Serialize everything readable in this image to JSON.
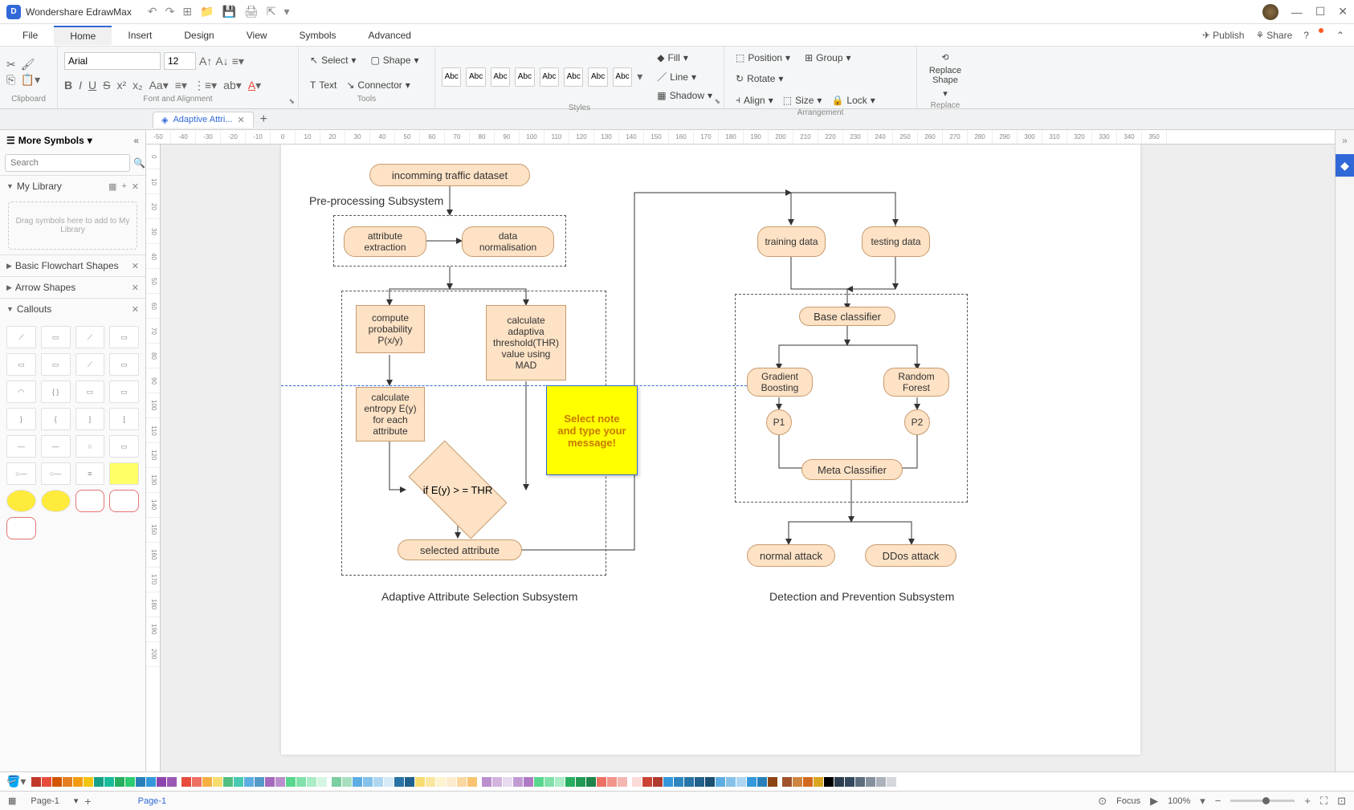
{
  "app": {
    "name": "Wondershare EdrawMax"
  },
  "qat_icons": [
    "undo-icon",
    "redo-icon",
    "new-icon",
    "open-icon",
    "save-icon",
    "print-icon",
    "export-icon",
    "more-icon"
  ],
  "menu": {
    "items": [
      "File",
      "Home",
      "Insert",
      "Design",
      "View",
      "Symbols",
      "Advanced"
    ],
    "active": 1,
    "publish": "Publish",
    "share": "Share"
  },
  "ribbon": {
    "clipboard_label": "Clipboard",
    "font_label": "Font and Alignment",
    "tools_label": "Tools",
    "styles_label": "Styles",
    "arrangement_label": "Arrangement",
    "replace_label": "Replace",
    "font_name": "Arial",
    "font_size": "12",
    "select": "Select",
    "shape": "Shape",
    "text": "Text",
    "connector": "Connector",
    "style_swatch": "Abc",
    "fill": "Fill",
    "line": "Line",
    "shadow": "Shadow",
    "position": "Position",
    "group": "Group",
    "align": "Align",
    "size": "Size",
    "rotate": "Rotate",
    "lock": "Lock",
    "replace_shape": "Replace Shape"
  },
  "doc_tab": {
    "name": "Adaptive Attri..."
  },
  "left": {
    "title": "More Symbols",
    "search_placeholder": "Search",
    "my_library": "My Library",
    "drop_hint": "Drag symbols here to add to My Library",
    "sections": [
      "Basic Flowchart Shapes",
      "Arrow Shapes",
      "Callouts"
    ]
  },
  "ruler_h": [
    "-50",
    "-40",
    "-30",
    "-20",
    "-10",
    "0",
    "10",
    "20",
    "30",
    "40",
    "50",
    "60",
    "70",
    "80",
    "90",
    "100",
    "110",
    "120",
    "130",
    "140",
    "150",
    "160",
    "170",
    "180",
    "190",
    "200",
    "210",
    "220",
    "230",
    "240",
    "250",
    "260",
    "270",
    "280",
    "290",
    "300",
    "310",
    "320",
    "330",
    "340",
    "350"
  ],
  "ruler_v": [
    "0",
    "10",
    "20",
    "30",
    "40",
    "50",
    "60",
    "70",
    "80",
    "90",
    "100",
    "110",
    "120",
    "130",
    "140",
    "150",
    "160",
    "170",
    "180",
    "190",
    "200"
  ],
  "flowchart": {
    "n_incoming": "incomming traffic dataset",
    "n_preproc_label": "Pre-processing Subsystem",
    "n_attr_ext": "attribute extraction",
    "n_data_norm": "data normalisation",
    "n_compute_prob": "compute probability P(x/y)",
    "n_calc_thr": "calculate adaptiva threshold(THR) value using MAD",
    "n_calc_entropy": "calculate entropy E(y) for each attribute",
    "n_decision": "if E(y) > = THR",
    "n_selected": "selected attribute",
    "n_adaptive_label": "Adaptive Attribute Selection Subsystem",
    "n_training": "training data",
    "n_testing": "testing data",
    "n_base": "Base classifier",
    "n_gb": "Gradient Boosting",
    "n_rf": "Random Forest",
    "n_p1": "P1",
    "n_p2": "P2",
    "n_meta": "Meta Classifier",
    "n_normal": "normal attack",
    "n_ddos": "DDos attack",
    "n_detect_label": "Detection and Prevention Subsystem",
    "sticky": "Select note and type your message!"
  },
  "page_tabs": {
    "p1": "Page-1",
    "current": "Page-1"
  },
  "status": {
    "focus": "Focus",
    "zoom": "100%"
  },
  "colors": [
    "#c0392b",
    "#e74c3c",
    "#d35400",
    "#e67e22",
    "#f39c12",
    "#f1c40f",
    "#16a085",
    "#1abc9c",
    "#27ae60",
    "#2ecc71",
    "#2980b9",
    "#3498db",
    "#8e44ad",
    "#9b59b6",
    "#e74c3c",
    "#ec7063",
    "#f5b041",
    "#f7dc6f",
    "#52be80",
    "#48c9b0",
    "#5dade2",
    "#5499c7",
    "#a569bd",
    "#bb8fce",
    "#58d68d",
    "#82e0aa",
    "#abebc6",
    "#d5f5e3",
    "#7dcea0",
    "#a9dfbf",
    "#5dade2",
    "#85c1e9",
    "#aed6f1",
    "#d6eaf8",
    "#2874a6",
    "#1f618d",
    "#f7dc6f",
    "#f9e79f",
    "#fcf3cf",
    "#fdebd0",
    "#fad7a0",
    "#f8c471",
    "#bb8fce",
    "#d2b4de",
    "#e8daef",
    "#c39bd3",
    "#af7ac5",
    "#58d68d",
    "#82e0aa",
    "#abebc6",
    "#27ae60",
    "#229954",
    "#1e8449",
    "#ec7063",
    "#f1948a",
    "#f5b7b1",
    "#fadbd8",
    "#cb4335",
    "#b03a2e",
    "#3498db",
    "#2e86c1",
    "#2874a6",
    "#21618c",
    "#1b4f72",
    "#5dade2",
    "#85c1e9",
    "#aed6f1",
    "#3498db",
    "#2980b9",
    "#8b4513",
    "#a0522d",
    "#cd853f",
    "#d2691e",
    "#daa520",
    "#000000",
    "#2c3e50",
    "#34495e",
    "#5d6d7e",
    "#85929e",
    "#abb2b9",
    "#d5d8dc",
    "#ffffff"
  ]
}
